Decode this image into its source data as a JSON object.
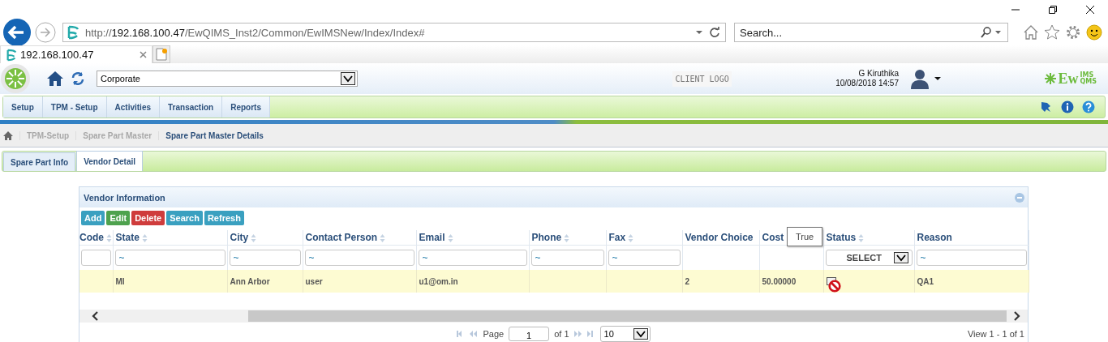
{
  "browser": {
    "address": {
      "scheme": "http://",
      "host": "192.168.100.47",
      "path": "/EwQIMS_Inst2/Common/EwIMSNew/Index/Index#"
    },
    "search": {
      "placeholder": "Search..."
    },
    "tabs": [
      {
        "title": "192.168.100.47",
        "selected": true
      }
    ]
  },
  "header": {
    "location": "Corporate",
    "client_logo": "CLIENT LOGO",
    "user": "G Kiruthika",
    "datetime": "10/08/2018 14:57",
    "logo": {
      "main": "Ew",
      "top": "IMS",
      "bottom": "QMS"
    }
  },
  "menu": [
    "Setup",
    "TPM - Setup",
    "Activities",
    "Transaction",
    "Reports"
  ],
  "breadcrumb": [
    {
      "label": "TPM-Setup",
      "current": false
    },
    {
      "label": "Spare Part Master",
      "current": false
    },
    {
      "label": "Spare Part Master Details",
      "current": true
    }
  ],
  "tabs": [
    {
      "label": "Spare Part Info",
      "selected": false
    },
    {
      "label": "Vendor Detail",
      "selected": true
    }
  ],
  "panel": {
    "title": "Vendor Information",
    "buttons": [
      {
        "label": "Add",
        "color": "#3aa0c0"
      },
      {
        "label": "Edit",
        "color": "#4ea24e"
      },
      {
        "label": "Delete",
        "color": "#cf3c3c"
      },
      {
        "label": "Search",
        "color": "#3aa0c0"
      },
      {
        "label": "Refresh",
        "color": "#3aa0c0"
      }
    ],
    "columns": [
      {
        "label": "Code",
        "sortable": true,
        "filter": {
          "kind": "text"
        }
      },
      {
        "label": "State",
        "sortable": true,
        "filter": {
          "kind": "text",
          "placeholder": "~"
        }
      },
      {
        "label": "City",
        "sortable": true,
        "filter": {
          "kind": "text",
          "placeholder": "~"
        }
      },
      {
        "label": "Contact Person",
        "sortable": true,
        "filter": {
          "kind": "text",
          "placeholder": "~"
        }
      },
      {
        "label": "Email",
        "sortable": true,
        "filter": {
          "kind": "text",
          "placeholder": "~"
        }
      },
      {
        "label": "Phone",
        "sortable": true,
        "filter": {
          "kind": "text",
          "placeholder": "~"
        }
      },
      {
        "label": "Fax",
        "sortable": true,
        "filter": {
          "kind": "text",
          "placeholder": "~"
        }
      },
      {
        "label": "Vendor Choice",
        "sortable": false
      },
      {
        "label": "Cost",
        "sortable": false
      },
      {
        "label": "Status",
        "sortable": true,
        "filter": {
          "kind": "select",
          "value": "SELECT"
        }
      },
      {
        "label": "Reason",
        "sortable": false,
        "filter": {
          "kind": "text",
          "placeholder": "~"
        }
      }
    ],
    "rows": [
      {
        "cells": [
          {
            "kind": "empty"
          },
          {
            "kind": "text",
            "text": "MI"
          },
          {
            "kind": "text",
            "text": "Ann Arbor"
          },
          {
            "kind": "text",
            "text": "user"
          },
          {
            "kind": "text",
            "text": "u1@om.in"
          },
          {
            "kind": "empty"
          },
          {
            "kind": "empty"
          },
          {
            "kind": "text",
            "text": "2"
          },
          {
            "kind": "text",
            "text": "50.00000"
          },
          {
            "kind": "checkbox",
            "checked": false
          },
          {
            "kind": "text",
            "text": "QA1"
          }
        ]
      }
    ],
    "tooltip": "True",
    "pager": {
      "page_label": "Page",
      "page": "1",
      "of": "of 1",
      "page_size": "10",
      "view": "View 1 - 1 of 1"
    }
  }
}
